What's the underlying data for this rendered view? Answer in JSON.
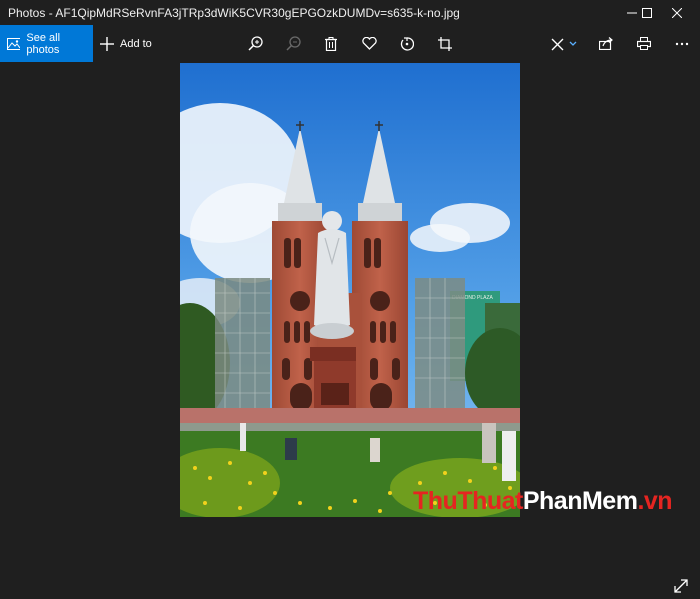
{
  "window": {
    "title": "Photos - AF1QipMdRSeRvnFA3jTRp3dWiK5CVR30gEPGOzkDUMDv=s635-k-no.jpg"
  },
  "toolbar": {
    "see_all_label": "See all photos",
    "add_to_label": "Add to"
  },
  "icons": {
    "see_all": "photos-icon",
    "add": "plus-icon",
    "zoom_in": "zoom-in-icon",
    "zoom_out": "zoom-out-icon",
    "delete": "trash-icon",
    "favorite": "heart-icon",
    "rotate": "rotate-icon",
    "crop": "crop-icon",
    "edit": "edit-create-icon",
    "share": "share-icon",
    "print": "print-icon",
    "more": "more-icon"
  },
  "photo": {
    "sign_text": "DIAMOND PLAZA"
  },
  "watermark": {
    "part1": "ThuThuat",
    "part2": "PhanMem",
    "part3": ".vn"
  },
  "colors": {
    "accent": "#0078d7",
    "background": "#1f1f1f"
  }
}
